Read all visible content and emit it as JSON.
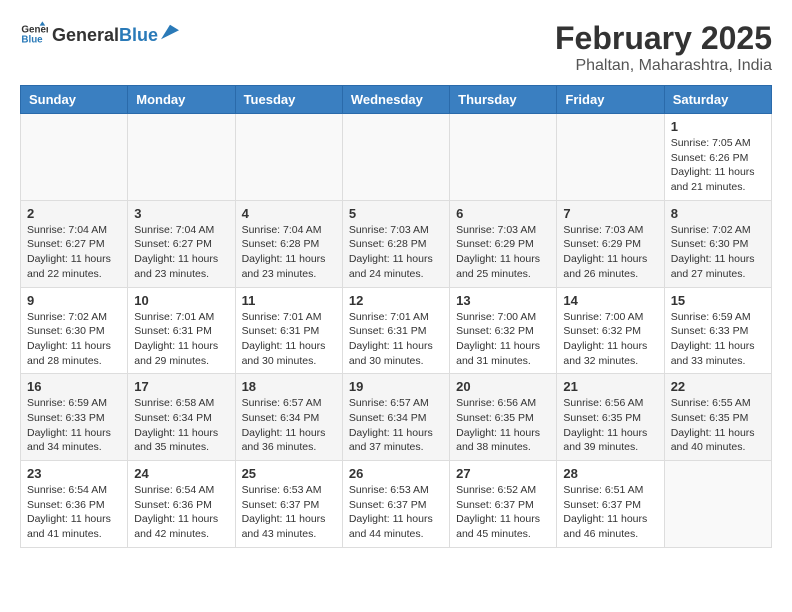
{
  "header": {
    "logo_general": "General",
    "logo_blue": "Blue",
    "month": "February 2025",
    "location": "Phaltan, Maharashtra, India"
  },
  "days_of_week": [
    "Sunday",
    "Monday",
    "Tuesday",
    "Wednesday",
    "Thursday",
    "Friday",
    "Saturday"
  ],
  "weeks": [
    [
      {
        "num": "",
        "info": ""
      },
      {
        "num": "",
        "info": ""
      },
      {
        "num": "",
        "info": ""
      },
      {
        "num": "",
        "info": ""
      },
      {
        "num": "",
        "info": ""
      },
      {
        "num": "",
        "info": ""
      },
      {
        "num": "1",
        "info": "Sunrise: 7:05 AM\nSunset: 6:26 PM\nDaylight: 11 hours\nand 21 minutes."
      }
    ],
    [
      {
        "num": "2",
        "info": "Sunrise: 7:04 AM\nSunset: 6:27 PM\nDaylight: 11 hours\nand 22 minutes."
      },
      {
        "num": "3",
        "info": "Sunrise: 7:04 AM\nSunset: 6:27 PM\nDaylight: 11 hours\nand 23 minutes."
      },
      {
        "num": "4",
        "info": "Sunrise: 7:04 AM\nSunset: 6:28 PM\nDaylight: 11 hours\nand 23 minutes."
      },
      {
        "num": "5",
        "info": "Sunrise: 7:03 AM\nSunset: 6:28 PM\nDaylight: 11 hours\nand 24 minutes."
      },
      {
        "num": "6",
        "info": "Sunrise: 7:03 AM\nSunset: 6:29 PM\nDaylight: 11 hours\nand 25 minutes."
      },
      {
        "num": "7",
        "info": "Sunrise: 7:03 AM\nSunset: 6:29 PM\nDaylight: 11 hours\nand 26 minutes."
      },
      {
        "num": "8",
        "info": "Sunrise: 7:02 AM\nSunset: 6:30 PM\nDaylight: 11 hours\nand 27 minutes."
      }
    ],
    [
      {
        "num": "9",
        "info": "Sunrise: 7:02 AM\nSunset: 6:30 PM\nDaylight: 11 hours\nand 28 minutes."
      },
      {
        "num": "10",
        "info": "Sunrise: 7:01 AM\nSunset: 6:31 PM\nDaylight: 11 hours\nand 29 minutes."
      },
      {
        "num": "11",
        "info": "Sunrise: 7:01 AM\nSunset: 6:31 PM\nDaylight: 11 hours\nand 30 minutes."
      },
      {
        "num": "12",
        "info": "Sunrise: 7:01 AM\nSunset: 6:31 PM\nDaylight: 11 hours\nand 30 minutes."
      },
      {
        "num": "13",
        "info": "Sunrise: 7:00 AM\nSunset: 6:32 PM\nDaylight: 11 hours\nand 31 minutes."
      },
      {
        "num": "14",
        "info": "Sunrise: 7:00 AM\nSunset: 6:32 PM\nDaylight: 11 hours\nand 32 minutes."
      },
      {
        "num": "15",
        "info": "Sunrise: 6:59 AM\nSunset: 6:33 PM\nDaylight: 11 hours\nand 33 minutes."
      }
    ],
    [
      {
        "num": "16",
        "info": "Sunrise: 6:59 AM\nSunset: 6:33 PM\nDaylight: 11 hours\nand 34 minutes."
      },
      {
        "num": "17",
        "info": "Sunrise: 6:58 AM\nSunset: 6:34 PM\nDaylight: 11 hours\nand 35 minutes."
      },
      {
        "num": "18",
        "info": "Sunrise: 6:57 AM\nSunset: 6:34 PM\nDaylight: 11 hours\nand 36 minutes."
      },
      {
        "num": "19",
        "info": "Sunrise: 6:57 AM\nSunset: 6:34 PM\nDaylight: 11 hours\nand 37 minutes."
      },
      {
        "num": "20",
        "info": "Sunrise: 6:56 AM\nSunset: 6:35 PM\nDaylight: 11 hours\nand 38 minutes."
      },
      {
        "num": "21",
        "info": "Sunrise: 6:56 AM\nSunset: 6:35 PM\nDaylight: 11 hours\nand 39 minutes."
      },
      {
        "num": "22",
        "info": "Sunrise: 6:55 AM\nSunset: 6:35 PM\nDaylight: 11 hours\nand 40 minutes."
      }
    ],
    [
      {
        "num": "23",
        "info": "Sunrise: 6:54 AM\nSunset: 6:36 PM\nDaylight: 11 hours\nand 41 minutes."
      },
      {
        "num": "24",
        "info": "Sunrise: 6:54 AM\nSunset: 6:36 PM\nDaylight: 11 hours\nand 42 minutes."
      },
      {
        "num": "25",
        "info": "Sunrise: 6:53 AM\nSunset: 6:37 PM\nDaylight: 11 hours\nand 43 minutes."
      },
      {
        "num": "26",
        "info": "Sunrise: 6:53 AM\nSunset: 6:37 PM\nDaylight: 11 hours\nand 44 minutes."
      },
      {
        "num": "27",
        "info": "Sunrise: 6:52 AM\nSunset: 6:37 PM\nDaylight: 11 hours\nand 45 minutes."
      },
      {
        "num": "28",
        "info": "Sunrise: 6:51 AM\nSunset: 6:37 PM\nDaylight: 11 hours\nand 46 minutes."
      },
      {
        "num": "",
        "info": ""
      }
    ]
  ]
}
